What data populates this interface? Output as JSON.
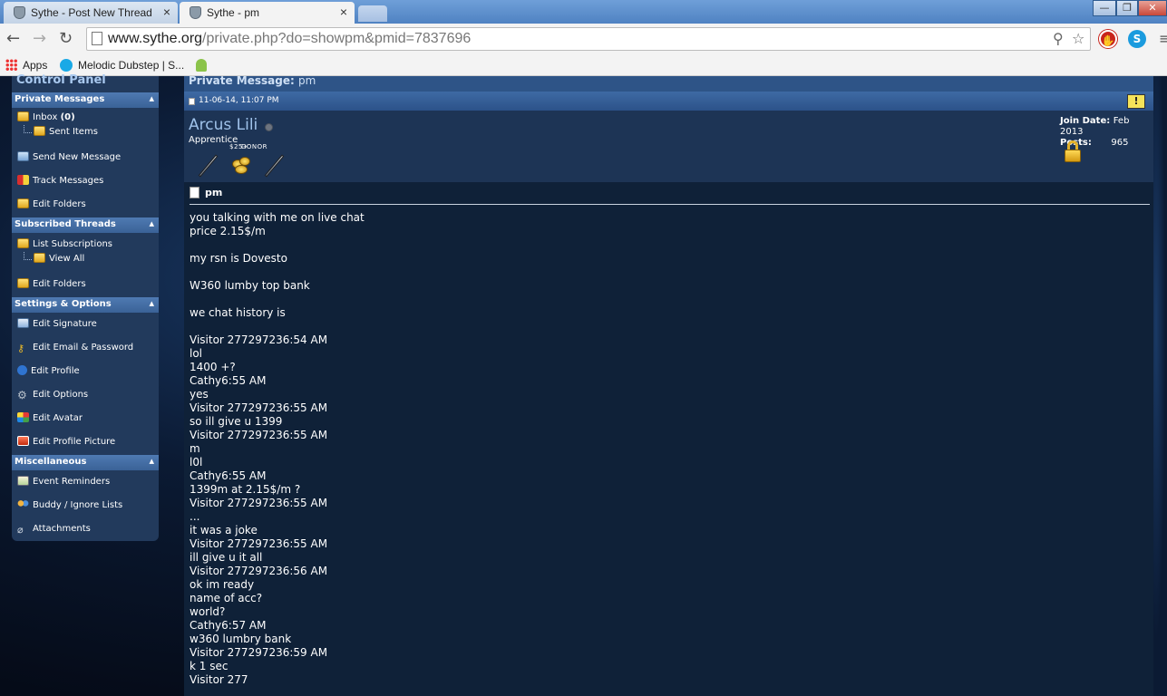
{
  "browser": {
    "tabs": [
      {
        "title": "Sythe - Post New Thread",
        "active": false
      },
      {
        "title": "Sythe - pm",
        "active": true
      }
    ],
    "url_host": "www.sythe.org",
    "url_path": "/private.php?do=showpm&pmid=7837696",
    "bookmarks": [
      {
        "label": "Apps"
      },
      {
        "label": "Melodic Dubstep | S..."
      }
    ],
    "window_buttons": {
      "minimize": "—",
      "maximize": "❐",
      "close": "✕"
    }
  },
  "sidebar": {
    "title": "Control Panel",
    "sections": [
      {
        "heading": "Private Messages",
        "items": [
          {
            "label": "Inbox",
            "count": "(0)"
          },
          {
            "label": "Sent Items"
          },
          {
            "label": "Send New Message"
          },
          {
            "label": "Track Messages"
          },
          {
            "label": "Edit Folders"
          }
        ]
      },
      {
        "heading": "Subscribed Threads",
        "items": [
          {
            "label": "List Subscriptions"
          },
          {
            "label": "View All"
          },
          {
            "label": "Edit Folders"
          }
        ]
      },
      {
        "heading": "Settings & Options",
        "items": [
          {
            "label": "Edit Signature"
          },
          {
            "label": "Edit Email & Password"
          },
          {
            "label": "Edit Profile"
          },
          {
            "label": "Edit Options"
          },
          {
            "label": "Edit Avatar"
          },
          {
            "label": "Edit Profile Picture"
          }
        ]
      },
      {
        "heading": "Miscellaneous",
        "items": [
          {
            "label": "Event Reminders"
          },
          {
            "label": "Buddy / Ignore Lists"
          },
          {
            "label": "Attachments"
          }
        ]
      }
    ]
  },
  "message": {
    "header_label": "Private Message:",
    "header_title": "pm",
    "date": "11-06-14, 11:07 PM",
    "sender": {
      "name": "Arcus Lili",
      "user_title": "Apprentice",
      "badge_labels": [
        "$25+",
        "DONOR"
      ],
      "join_date_label": "Join Date:",
      "join_date": "Feb 2013",
      "posts_label": "Posts:",
      "posts": "965"
    },
    "title": "pm",
    "lines": [
      "you talking with me on live chat",
      "price 2.15$/m",
      "",
      "my rsn is Dovesto",
      "",
      "W360 lumby top bank",
      "",
      "we chat history is",
      "",
      "Visitor 277297236:54 AM",
      "lol",
      "1400 +?",
      "Cathy6:55 AM",
      "yes",
      "Visitor 277297236:55 AM",
      "so ill give u 1399",
      "Visitor 277297236:55 AM",
      "m",
      "l0l",
      "Cathy6:55 AM",
      "1399m at 2.15$/m ?",
      "Visitor 277297236:55 AM",
      "...",
      "it was a joke",
      "Visitor 277297236:55 AM",
      "ill give u it all",
      "Visitor 277297236:56 AM",
      "ok im ready",
      "name of acc?",
      "world?",
      "Cathy6:57 AM",
      "w360 lumbry bank",
      "Visitor 277297236:59 AM",
      "k 1 sec",
      "Visitor 277"
    ]
  }
}
